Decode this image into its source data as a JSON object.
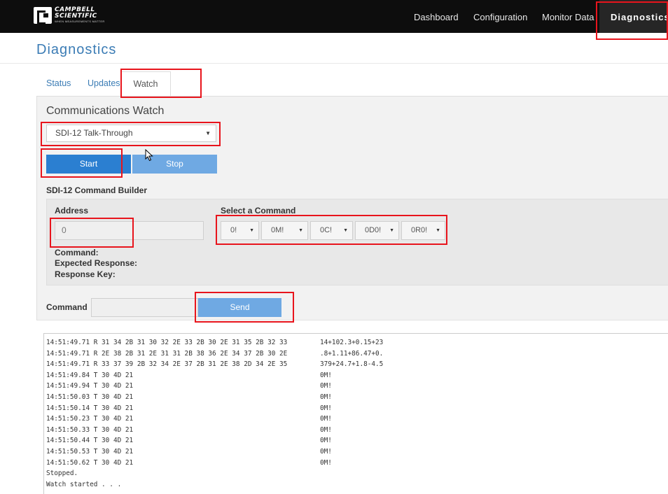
{
  "brand": {
    "line1": "CAMPBELL",
    "line2": "SCIENTIFIC",
    "tagline": "WHEN MEASUREMENTS MATTER"
  },
  "nav": {
    "dashboard": "Dashboard",
    "configuration": "Configuration",
    "monitor": "Monitor Data",
    "diagnostics": "Diagnostics"
  },
  "page_title": "Diagnostics",
  "tabs": {
    "status": "Status",
    "updates": "Updates",
    "watch": "Watch"
  },
  "watch": {
    "title": "Communications Watch",
    "selected": "SDI-12 Talk-Through",
    "start": "Start",
    "stop": "Stop"
  },
  "builder": {
    "title": "SDI-12 Command Builder",
    "address_label": "Address",
    "address_value": "0",
    "select_label": "Select a Command",
    "commands": [
      "0!",
      "0M!",
      "0C!",
      "0D0!",
      "0R0!"
    ],
    "command_label": "Command:",
    "expected_label": "Expected Response:",
    "key_label": "Response Key:"
  },
  "command_row": {
    "label": "Command",
    "send": "Send"
  },
  "log": [
    {
      "raw": "14:51:49.71 R 31 34 2B 31 30 32 2E 33 2B 30 2E 31 35 2B 32 33",
      "ascii": "14+102.3+0.15+23"
    },
    {
      "raw": "14:51:49.71 R 2E 38 2B 31 2E 31 31 2B 38 36 2E 34 37 2B 30 2E",
      "ascii": ".8+1.11+86.47+0."
    },
    {
      "raw": "14:51:49.71 R 33 37 39 2B 32 34 2E 37 2B 31 2E 38 2D 34 2E 35",
      "ascii": "379+24.7+1.8-4.5"
    },
    {
      "raw": "14:51:49.84 T 30 4D 21",
      "ascii": "0M!"
    },
    {
      "raw": "14:51:49.94 T 30 4D 21",
      "ascii": "0M!"
    },
    {
      "raw": "14:51:50.03 T 30 4D 21",
      "ascii": "0M!"
    },
    {
      "raw": "14:51:50.14 T 30 4D 21",
      "ascii": "0M!"
    },
    {
      "raw": "14:51:50.23 T 30 4D 21",
      "ascii": "0M!"
    },
    {
      "raw": "14:51:50.33 T 30 4D 21",
      "ascii": "0M!"
    },
    {
      "raw": "14:51:50.44 T 30 4D 21",
      "ascii": "0M!"
    },
    {
      "raw": "14:51:50.53 T 30 4D 21",
      "ascii": "0M!"
    },
    {
      "raw": "14:51:50.62 T 30 4D 21",
      "ascii": "0M!"
    },
    {
      "raw": "Stopped.",
      "ascii": ""
    },
    {
      "raw": "Watch started . . .",
      "ascii": ""
    }
  ],
  "colors": {
    "accent": "#3b7cb5",
    "primary_button": "#2b7fd1",
    "disabled_button": "#6fa9e3",
    "annotation": "#e8141c",
    "navbar": "#0d0d0d"
  }
}
